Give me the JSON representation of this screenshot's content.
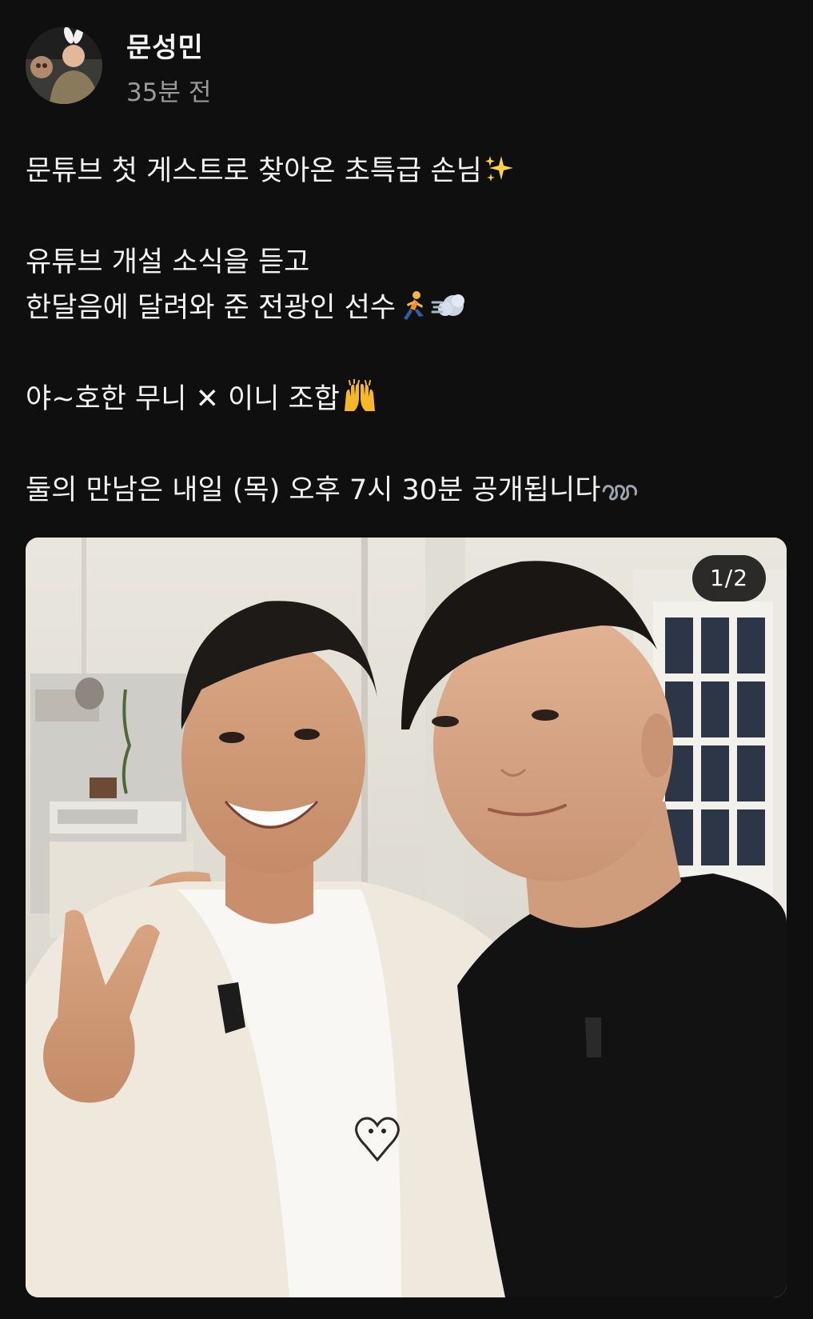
{
  "post": {
    "author": {
      "name": "문성민",
      "time": "35분 전"
    },
    "body": {
      "line1": "문튜브 첫 게스트로 찾아온 초특급 손님",
      "line2": "유튜브 개설 소식을 듣고",
      "line3": "한달음에 달려와 준 전광인 선수",
      "line4": "야~호한 무니 ✕ 이니 조합",
      "line5": "둘의 만남은 내일 (목) 오후 7시 30분 공개됩니다"
    },
    "emojis": {
      "line1": "sparkles-icon",
      "line3": [
        "running-person-icon",
        "dash-cloud-icon"
      ],
      "line4": "raised-hands-icon",
      "line5": "curly-loop-icon"
    },
    "media": {
      "counter": "1/2",
      "image_alt": "two men smiling for a selfie indoors"
    },
    "colors": {
      "background": "#0f0f10",
      "text": "#f3f3f3",
      "muted": "#9a9a9a"
    }
  }
}
